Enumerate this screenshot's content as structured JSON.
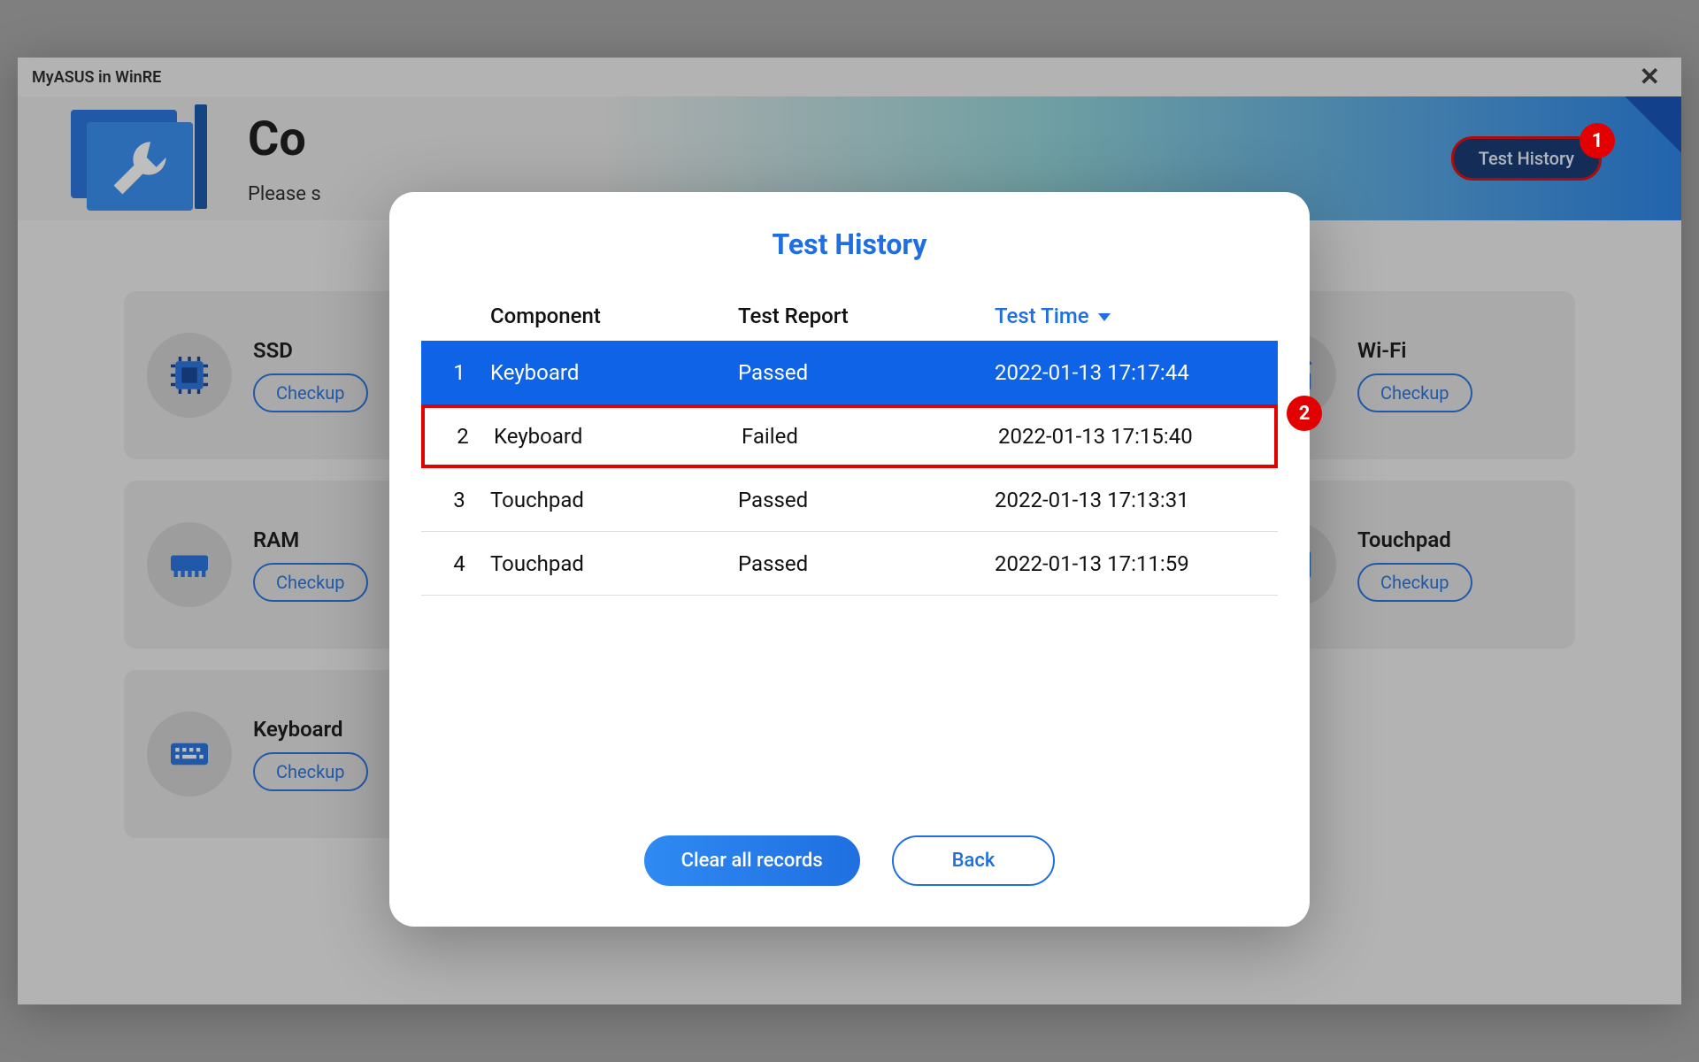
{
  "window": {
    "title": "MyASUS in WinRE"
  },
  "banner": {
    "title_prefix": "Co",
    "subtitle_prefix": "Please s",
    "test_history_button": "Test History"
  },
  "annotations": {
    "a1": "1",
    "a2": "2"
  },
  "cards": {
    "checkup_label": "Checkup",
    "items": [
      {
        "name": "SSD",
        "icon": "chip"
      },
      {
        "name": "Wi-Fi",
        "icon": "wifi"
      },
      {
        "name": "RAM",
        "icon": "ram"
      },
      {
        "name": "Touchpad",
        "icon": "touchpad"
      },
      {
        "name": "Keyboard",
        "icon": "keyboard"
      }
    ]
  },
  "modal": {
    "title": "Test History",
    "columns": {
      "component": "Component",
      "report": "Test Report",
      "time": "Test Time"
    },
    "rows": [
      {
        "idx": "1",
        "component": "Keyboard",
        "report": "Passed",
        "time": "2022-01-13 17:17:44",
        "selected": true
      },
      {
        "idx": "2",
        "component": "Keyboard",
        "report": "Failed",
        "time": "2022-01-13 17:15:40",
        "highlight": true
      },
      {
        "idx": "3",
        "component": "Touchpad",
        "report": "Passed",
        "time": "2022-01-13 17:13:31"
      },
      {
        "idx": "4",
        "component": "Touchpad",
        "report": "Passed",
        "time": "2022-01-13 17:11:59"
      }
    ],
    "actions": {
      "clear": "Clear all records",
      "back": "Back"
    }
  }
}
